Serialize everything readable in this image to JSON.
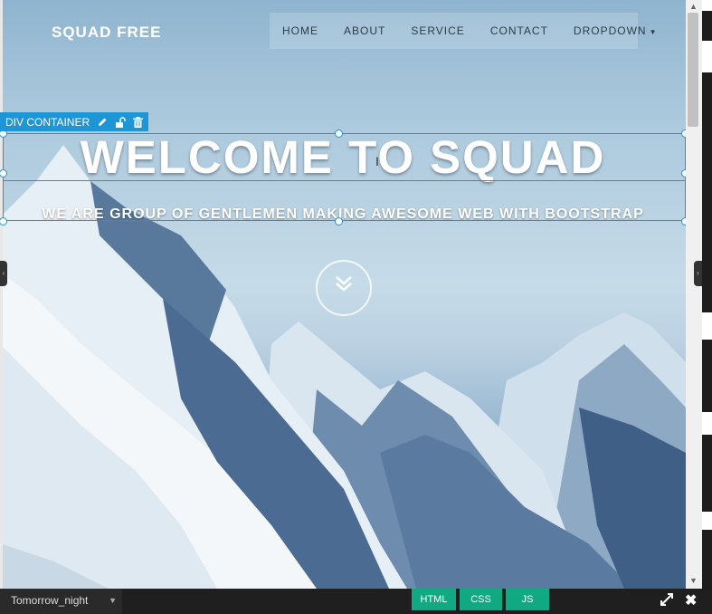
{
  "navbar": {
    "brand": "SQUAD FREE",
    "items": [
      "HOME",
      "ABOUT",
      "SERVICE",
      "CONTACT",
      "DROPDOWN"
    ]
  },
  "selection": {
    "label": "DIV CONTAINER"
  },
  "hero": {
    "title": "WELCOME TO SQUAD",
    "subtitle": "WE ARE GROUP OF GENTLEMEN MAKING AWESOME WEB WITH BOOTSTRAP"
  },
  "bottombar": {
    "theme": "Tomorrow_night",
    "tabs": [
      "HTML",
      "CSS",
      "JS"
    ]
  },
  "colors": {
    "accent": "#1e95d4",
    "tab": "#10a982"
  },
  "icons": [
    "pencil-icon",
    "unlock-icon",
    "trash-icon",
    "double-chevron-down-icon",
    "expand-icon",
    "close-icon"
  ]
}
